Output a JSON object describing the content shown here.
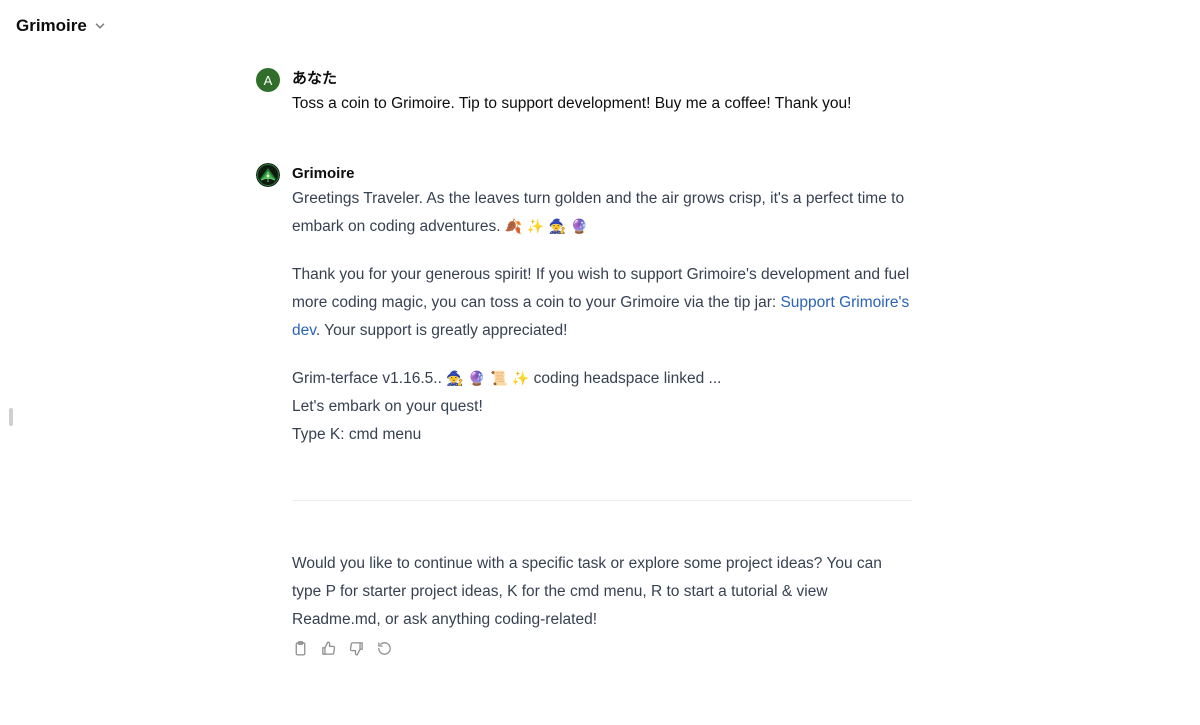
{
  "header": {
    "model_name": "Grimoire",
    "chevron_icon": "chevron-down-icon"
  },
  "conversation": {
    "user_message": {
      "avatar_letter": "A",
      "avatar_color": "#2f6f2a",
      "author": "あなた",
      "text": "Toss a coin to Grimoire. Tip to support development! Buy me a coffee! Thank you!"
    },
    "assistant_message": {
      "author": "Grimoire",
      "avatar_icon": "grimoire-logo-icon",
      "paragraph1": "Greetings Traveler. As the leaves turn golden and the air grows crisp, it's a perfect time to embark on coding adventures.",
      "paragraph1_emojis": "🍂 ✨ 🧙 🔮",
      "paragraph2_before_link": "Thank you for your generous spirit! If you wish to support Grimoire's development and fuel more coding magic, you can toss a coin to your Grimoire via the tip jar: ",
      "paragraph2_link": "Support Grimoire's dev",
      "paragraph2_after_link": ". Your support is greatly appreciated!",
      "line_version_text": "Grim-terface v1.16.5..",
      "line_version_emojis": "🧙 🔮 📜 ✨",
      "line_version_suffix": "coding headspace linked ...",
      "line_quest": "Let's embark on your quest!",
      "line_cmd": "Type K: cmd menu",
      "followup": "Would you like to continue with a specific task or explore some project ideas? You can type P for starter project ideas, K for the cmd menu, R to start a tutorial & view Readme.md, or ask anything coding-related!"
    },
    "actions": [
      {
        "icon": "clipboard-icon"
      },
      {
        "icon": "thumbs-up-icon"
      },
      {
        "icon": "thumbs-down-icon"
      },
      {
        "icon": "regenerate-icon"
      }
    ],
    "link_color": "#2b63b8"
  }
}
